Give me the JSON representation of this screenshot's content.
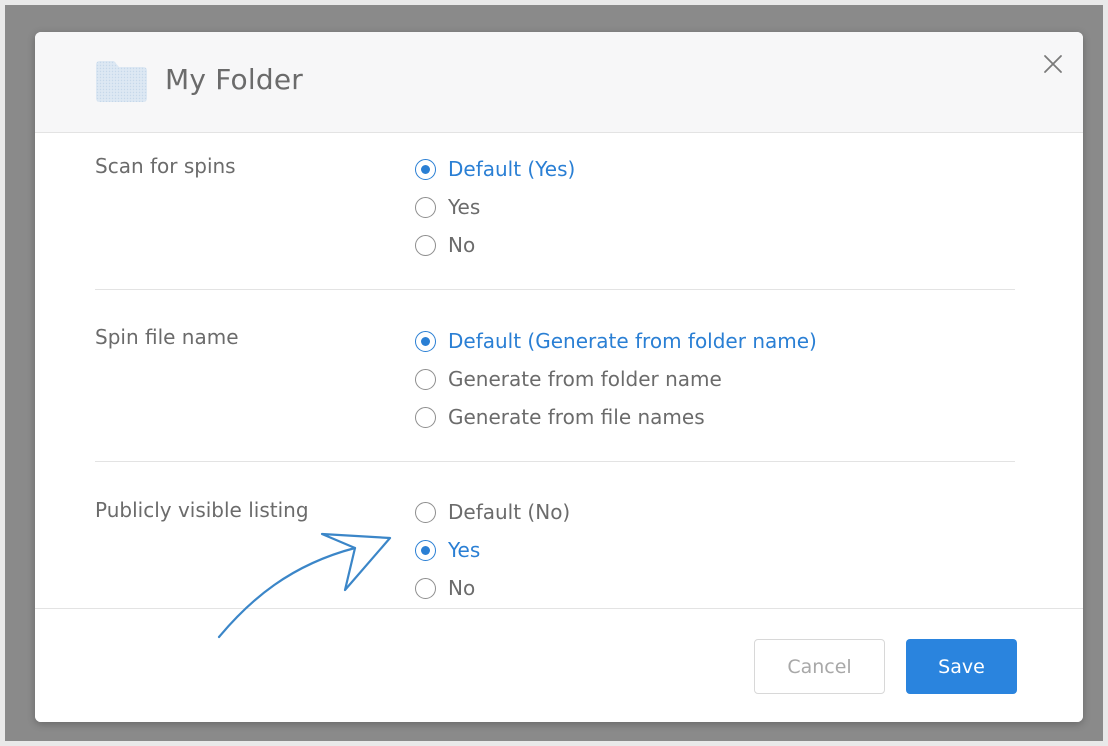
{
  "dialog": {
    "title": "My Folder",
    "close_icon": "close-icon",
    "folder_icon": "folder-icon"
  },
  "sections": [
    {
      "label": "Scan for spins",
      "options": [
        {
          "label": "Default (Yes)",
          "selected": true
        },
        {
          "label": "Yes",
          "selected": false
        },
        {
          "label": "No",
          "selected": false
        }
      ]
    },
    {
      "label": "Spin file name",
      "options": [
        {
          "label": "Default (Generate from folder name)",
          "selected": true
        },
        {
          "label": "Generate from folder name",
          "selected": false
        },
        {
          "label": "Generate from file names",
          "selected": false
        }
      ]
    },
    {
      "label": "Publicly visible listing",
      "options": [
        {
          "label": "Default (No)",
          "selected": false
        },
        {
          "label": "Yes",
          "selected": true
        },
        {
          "label": "No",
          "selected": false
        }
      ]
    }
  ],
  "footer": {
    "cancel_label": "Cancel",
    "save_label": "Save"
  },
  "colors": {
    "accent": "#2a7fd4",
    "save_button": "#2a84de",
    "text": "#6b6b6b"
  }
}
